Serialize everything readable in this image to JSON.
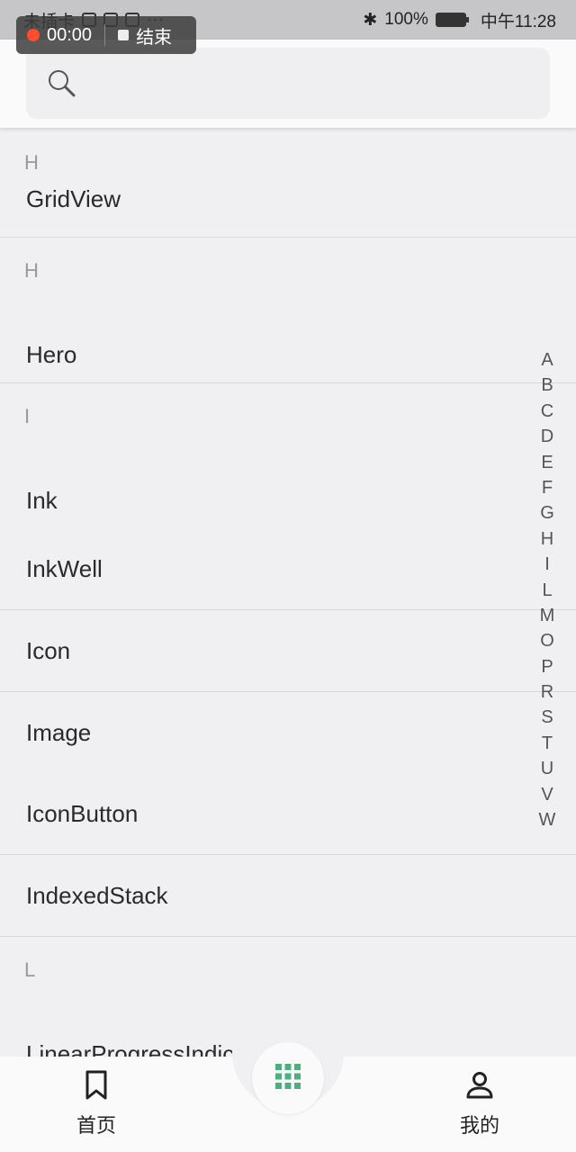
{
  "status_bar": {
    "left_text": "未插卡",
    "battery": "100%",
    "time": "中午11:28"
  },
  "recorder": {
    "timer": "00:00",
    "stop_label": "结束"
  },
  "search": {
    "placeholder": ""
  },
  "list": {
    "sec_h1": "H",
    "item_gridview": "GridView",
    "sec_h2": "H",
    "item_hero": "Hero",
    "sec_i": "I",
    "item_ink": "Ink",
    "item_inkwell": "InkWell",
    "item_icon": "Icon",
    "item_image": "Image",
    "item_iconbutton": "IconButton",
    "item_indexedstack": "IndexedStack",
    "sec_l": "L",
    "item_linear": "LinearProgressIndicator"
  },
  "index_bar": {
    "l0": "A",
    "l1": "B",
    "l2": "C",
    "l3": "D",
    "l4": "E",
    "l5": "F",
    "l6": "G",
    "l7": "H",
    "l8": "I",
    "l9": "L",
    "l10": "M",
    "l11": "O",
    "l12": "P",
    "l13": "R",
    "l14": "S",
    "l15": "T",
    "l16": "U",
    "l17": "V",
    "l18": "W"
  },
  "bottom_nav": {
    "home_label": "首页",
    "mine_label": "我的"
  },
  "colors": {
    "fab_grid": "#4caf7d",
    "recorder_dot": "#ff4d2e"
  }
}
